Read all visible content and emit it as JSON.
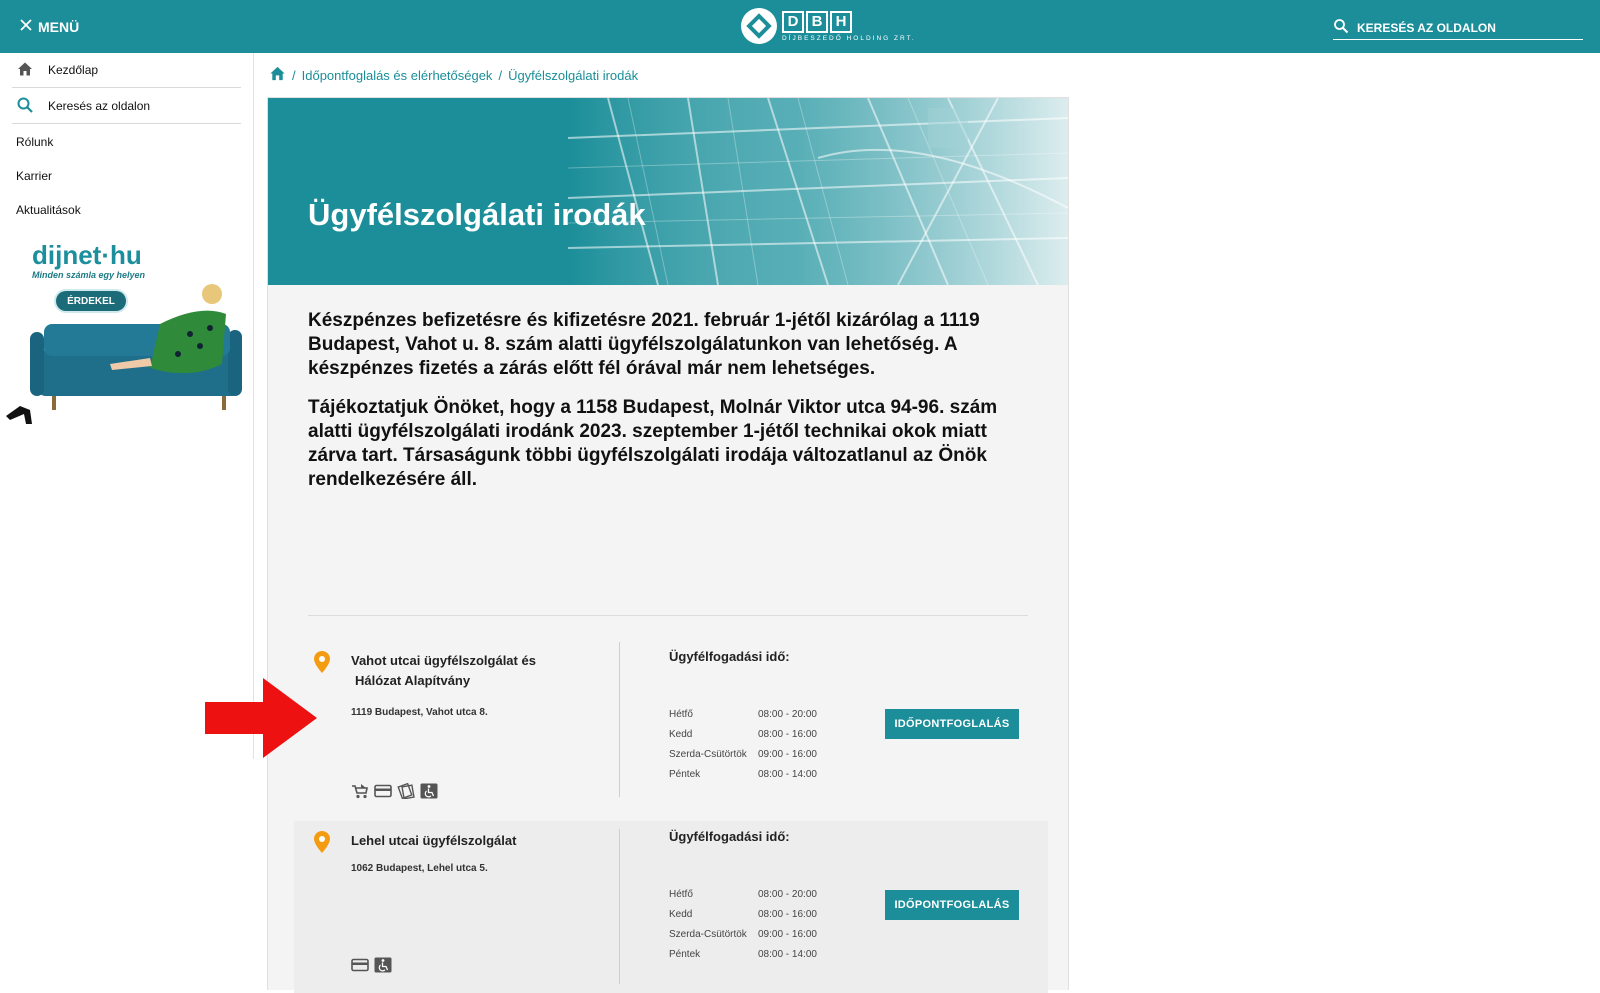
{
  "topbar": {
    "menu_label": "MENÜ",
    "logo_letters": [
      "D",
      "B",
      "H"
    ],
    "logo_subtitle": "DÍJBESZEDŐ HOLDING ZRT.",
    "search_label": "KERESÉS AZ OLDALON",
    "brand_color": "#1b8e99"
  },
  "sidebar": {
    "home_label": "Kezdőlap",
    "search_label": "Keresés az oldalon",
    "items": [
      "Rólunk",
      "Karrier",
      "Aktualitások"
    ],
    "ad": {
      "logo_text": "dijnet·hu",
      "tagline": "Minden számla egy helyen",
      "button_label": "ÉRDEKEL"
    }
  },
  "breadcrumb": {
    "items": [
      "Időpontfoglalás és elérhetőségek",
      "Ügyfélszolgálati irodák"
    ],
    "separator": "/"
  },
  "hero": {
    "title": "Ügyfélszolgálati irodák"
  },
  "notices": [
    "Készpénzes befizetésre és kifizetésre 2021. február 1-jétől kizárólag a 1119 Budapest, Vahot u. 8. szám alatti ügyfélszolgálatunkon van lehetőség. A készpénzes fizetés a zárás előtt fél órával már nem lehetséges.",
    "Tájékoztatjuk Önöket, hogy a 1158 Budapest, Molnár Viktor utca 94-96. szám alatti ügyfélszolgálati irodánk 2023. szeptember 1-jétől technikai okok miatt zárva tart. Társaságunk többi ügyfélszolgálati irodája változatlanul az Önök rendelkezésére áll."
  ],
  "offices": [
    {
      "name_line1": "Vahot utcai ügyfélszolgálat és",
      "name_line2": "Hálózat Alapítvány",
      "address": "1119 Budapest, Vahot utca 8.",
      "amenities": [
        "stroller-icon",
        "card-icon",
        "money-icon",
        "wheelchair-icon"
      ],
      "hours_title": "Ügyfélfogadási idő:",
      "hours": [
        {
          "day": "Hétfő",
          "time": "08:00 - 20:00"
        },
        {
          "day": "Kedd",
          "time": "08:00 - 16:00"
        },
        {
          "day": "Szerda-Csütörtök",
          "time": "09:00 - 16:00"
        },
        {
          "day": "Péntek",
          "time": "08:00 - 14:00"
        }
      ],
      "button_label": "IDŐPONTFOGLALÁS"
    },
    {
      "name_line1": "Lehel utcai ügyfélszolgálat",
      "address": "1062 Budapest, Lehel utca 5.",
      "amenities": [
        "card-icon",
        "wheelchair-icon"
      ],
      "hours_title": "Ügyfélfogadási idő:",
      "hours": [
        {
          "day": "Hétfő",
          "time": "08:00 - 20:00"
        },
        {
          "day": "Kedd",
          "time": "08:00 - 16:00"
        },
        {
          "day": "Szerda-Csütörtök",
          "time": "09:00 - 16:00"
        },
        {
          "day": "Péntek",
          "time": "08:00 - 14:00"
        }
      ],
      "button_label": "IDŐPONTFOGLALÁS"
    }
  ],
  "colors": {
    "accent": "#1b8e99",
    "pin": "#f39c12",
    "annotation_arrow": "#ee1111"
  }
}
